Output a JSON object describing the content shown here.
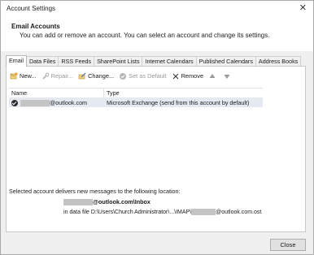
{
  "window": {
    "title": "Account Settings",
    "close_glyph": "✕"
  },
  "header": {
    "title": "Email Accounts",
    "description": "You can add or remove an account. You can select an account and change its settings."
  },
  "tabs": [
    {
      "label": "Email",
      "active": true
    },
    {
      "label": "Data Files"
    },
    {
      "label": "RSS Feeds"
    },
    {
      "label": "SharePoint Lists"
    },
    {
      "label": "Internet Calendars"
    },
    {
      "label": "Published Calendars"
    },
    {
      "label": "Address Books"
    }
  ],
  "toolbar": {
    "new": "New...",
    "repair": "Repair...",
    "change": "Change...",
    "set_default": "Set as Default",
    "remove": "Remove"
  },
  "list": {
    "col_name": "Name",
    "col_type": "Type",
    "rows": [
      {
        "name": "@outlook.com",
        "type": "Microsoft Exchange (send from this account by default)"
      }
    ]
  },
  "delivery": {
    "label": "Selected account delivers new messages to the following location:",
    "folder": "@outlook.com\\Inbox",
    "file_prefix": "in data file D:\\Users\\Church Administrator\\...\\IMAP\\",
    "file_suffix": "@outlook.com.ost"
  },
  "footer": {
    "close_label": "Close"
  },
  "colors": {
    "selection": "#e5eaf2",
    "background": "#f0f0f0"
  }
}
